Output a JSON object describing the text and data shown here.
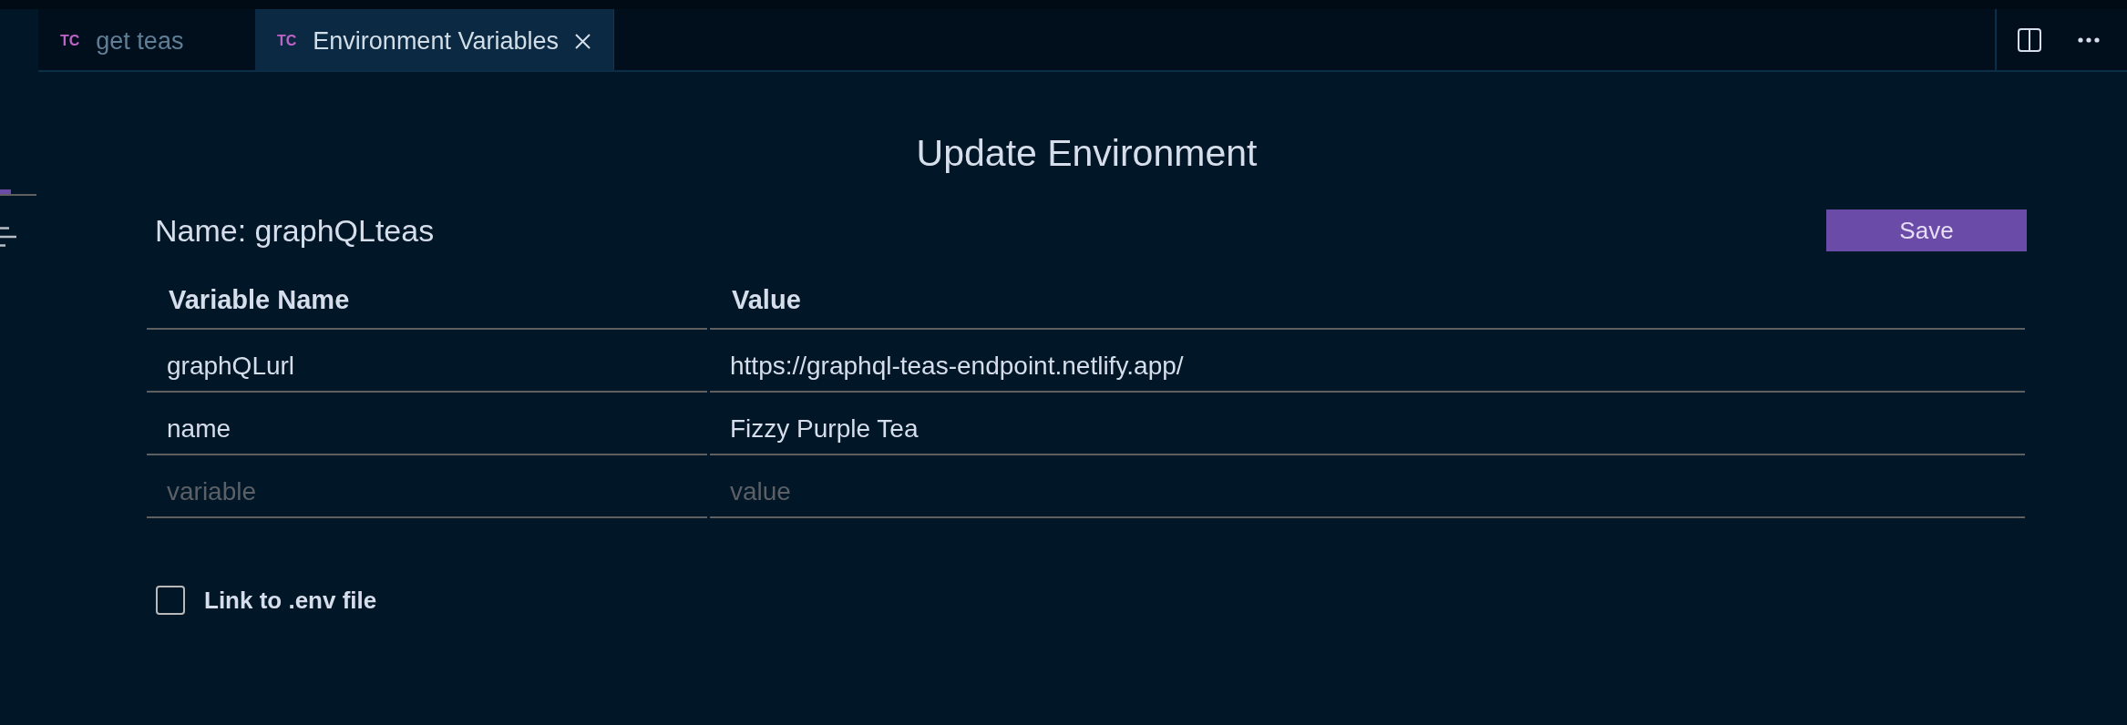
{
  "tabs": [
    {
      "badge": "TC",
      "label": "get teas",
      "selected": false
    },
    {
      "badge": "TC",
      "label": "Environment Variables",
      "selected": true
    }
  ],
  "editor": {
    "title": "Update Environment",
    "name_label": "Name: graphQLteas",
    "save_button": "Save"
  },
  "table": {
    "columns": [
      "Variable Name",
      "Value"
    ],
    "rows": [
      {
        "variable": "graphQLurl",
        "value": "https://graphql-teas-endpoint.netlify.app/"
      },
      {
        "variable": "name",
        "value": "Fizzy Purple Tea"
      }
    ],
    "new_row": {
      "variable": {
        "placeholder": "variable"
      },
      "value": {
        "placeholder": "value"
      }
    }
  },
  "link_env_file": {
    "label": "Link to .env file",
    "checked": false
  }
}
